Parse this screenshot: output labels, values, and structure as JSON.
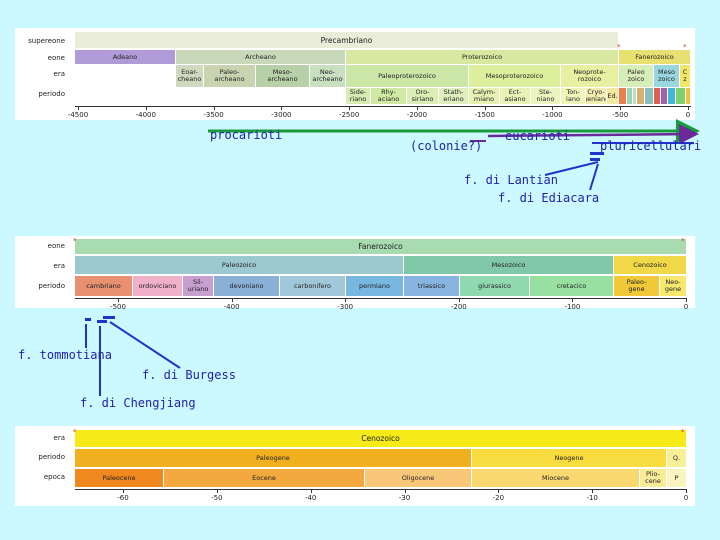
{
  "panel1": {
    "labels": {
      "supereone": "supereone",
      "eone": "eone",
      "era": "era",
      "periodo": "periodo"
    },
    "supereone": "Precambriano",
    "eons": [
      "Adeano",
      "Archeano",
      "Proterozoico",
      "Fanerozoico"
    ],
    "eras": [
      "Eoar-\ncheano",
      "Paleo-\narcheano",
      "Meso-\narcheano",
      "Neo-\narcheano",
      "Paleoproterozoico",
      "Mesoproterozoico",
      "Neoprote-\nrozoico",
      "Paleo\nzoico",
      "Meso\nzoico",
      "C\nz"
    ],
    "periods": [
      "Side-\nriano",
      "Rhy-\naciano",
      "Oro-\nsiriano",
      "Stath-\neriano",
      "Calym-\nmiano",
      "Ect-\nasiano",
      "Ste-\nniano",
      "Ton-\niano",
      "Cryo-\ngeniano",
      "Ed."
    ],
    "ticks": [
      "-4500",
      "-4000",
      "-3500",
      "-3000",
      "-2500",
      "-2000",
      "-1500",
      "-1000",
      "-500",
      "0"
    ]
  },
  "panel2": {
    "labels": {
      "eone": "eone",
      "era": "era",
      "periodo": "periodo"
    },
    "eon": "Fanerozoico",
    "eras": [
      "Paleozoico",
      "Mesozoico",
      "Cenozoico"
    ],
    "periods": [
      "cambriano",
      "ordoviciano",
      "Sil-\nuriano",
      "devoniano",
      "carbonifero",
      "permiano",
      "triassico",
      "giurassico",
      "cretacico",
      "Paleo-\ngene",
      "Neo-\ngene"
    ],
    "ticks": [
      "-500",
      "-400",
      "-300",
      "-200",
      "-100",
      "0"
    ]
  },
  "panel3": {
    "labels": {
      "era": "era",
      "periodo": "periodo",
      "epoca": "epoca"
    },
    "era": "Cenozoico",
    "periods": [
      "Paleogene",
      "Neogene",
      "Q."
    ],
    "epochs": [
      "Paleocene",
      "Eocene",
      "Oligocene",
      "Miocene",
      "Plio-\ncene",
      "P"
    ],
    "ticks": [
      "-60",
      "-50",
      "-40",
      "-30",
      "-20",
      "-10",
      "0"
    ]
  },
  "annotations": {
    "procarioti": "procarioti",
    "colonie": "(colonie?)",
    "eucarioti": "eucarioti",
    "pluricellulari": "pluricellulari",
    "lantian": "f. di Lantian",
    "ediacara": "f. di Ediacara",
    "tommotiana": "f. tommotiana",
    "burgess": "f. di Burgess",
    "chengjiang": "f. di Chengjiang"
  },
  "colors": {
    "background": "#ccf9ff",
    "arrow_green": "#1a9a3a",
    "arrow_purple": "#6a2a9a",
    "arrow_blue": "#2233cc"
  }
}
